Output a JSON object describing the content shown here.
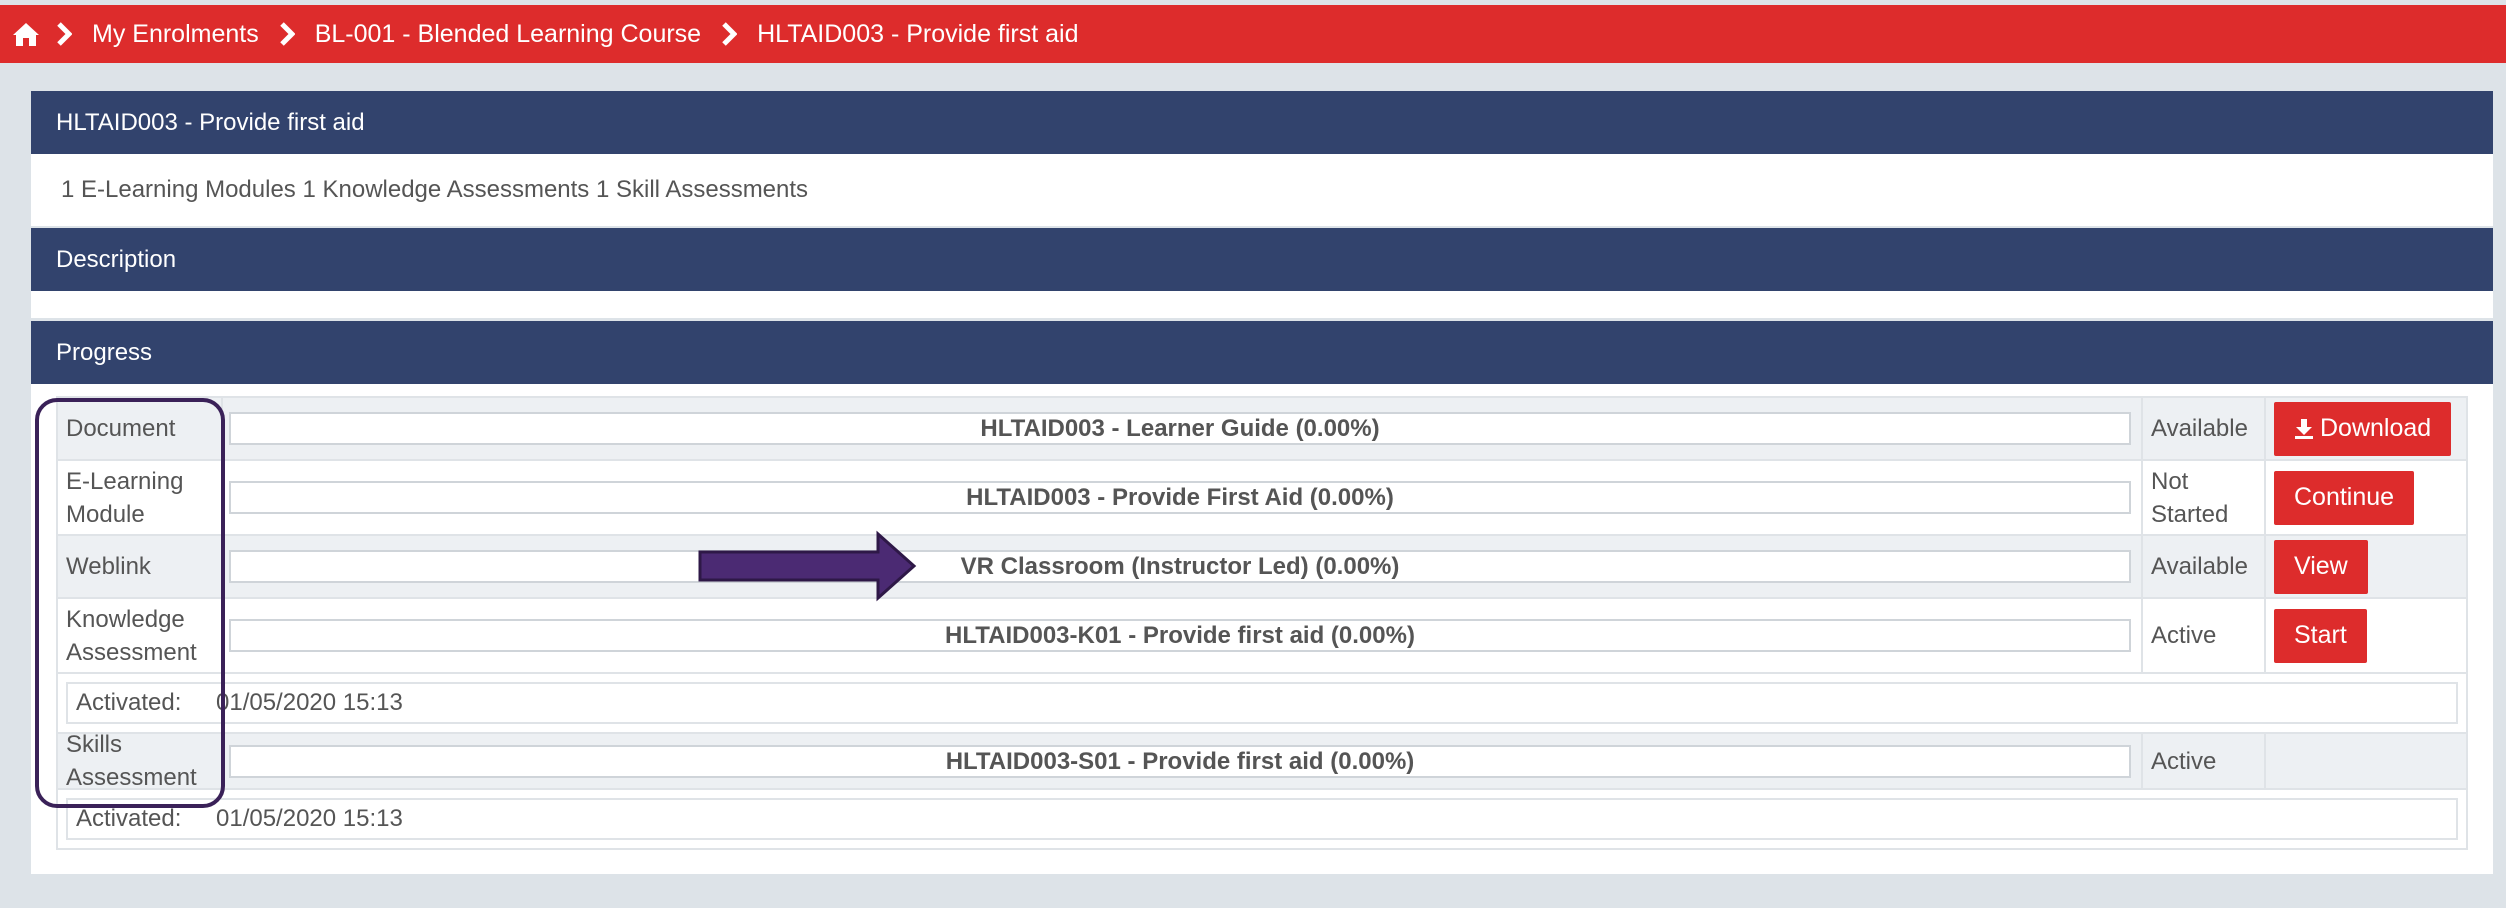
{
  "breadcrumb": {
    "items": [
      "My Enrolments",
      "BL-001 - Blended Learning Course",
      "HLTAID003 - Provide first aid"
    ]
  },
  "course_panel": {
    "title": "HLTAID003 - Provide first aid",
    "summary": "1 E-Learning Modules 1 Knowledge Assessments 1 Skill Assessments"
  },
  "description_panel": {
    "title": "Description"
  },
  "progress_panel": {
    "title": "Progress",
    "rows": [
      {
        "type": "Document",
        "name": "HLTAID003 - Learner Guide (0.00%)",
        "status": "Available",
        "action": "Download"
      },
      {
        "type": "E-Learning Module",
        "name": "HLTAID003 - Provide First Aid (0.00%)",
        "status": "Not Started",
        "action": "Continue"
      },
      {
        "type": "Weblink",
        "name": "VR Classroom (Instructor Led) (0.00%)",
        "status": "Available",
        "action": "View"
      },
      {
        "type": "Knowledge Assessment",
        "name": "HLTAID003-K01 - Provide first aid (0.00%)",
        "status": "Active",
        "action": "Start",
        "activated_label": "Activated:",
        "activated_value": "01/05/2020 15:13"
      },
      {
        "type": "Skills Assessment",
        "name": "HLTAID003-S01 - Provide first aid (0.00%)",
        "status": "Active",
        "action": "",
        "activated_label": "Activated:",
        "activated_value": "01/05/2020 15:13"
      }
    ]
  },
  "icons": {
    "home": "home-icon",
    "chevron": "chevron-right-icon",
    "download": "download-icon"
  },
  "colors": {
    "accent": "#dd2c2c",
    "panel_header": "#32436d",
    "annotation": "#3a2158"
  }
}
